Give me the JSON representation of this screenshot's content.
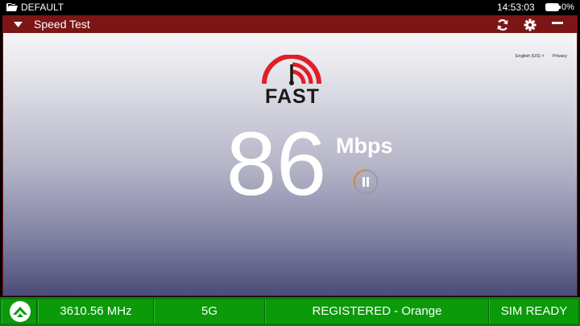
{
  "status": {
    "profile": "DEFAULT",
    "time": "14:53:03",
    "battery": "0%"
  },
  "window": {
    "title": "Speed Test"
  },
  "page": {
    "language": "English (US) ˅",
    "privacy": "Privacy",
    "logo": "FAST",
    "speed": "86",
    "unit": "Mbps"
  },
  "footer": {
    "frequency": "3610.56 MHz",
    "network": "5G",
    "registration": "REGISTERED - Orange",
    "sim": "SIM READY"
  },
  "colors": {
    "titlebar": "#7c1515",
    "footer": "#0a9a0a",
    "accent": "#e21e26"
  }
}
